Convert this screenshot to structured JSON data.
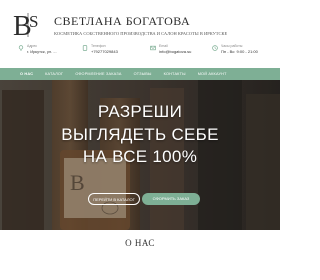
{
  "brand": {
    "name": "СВЕТЛАНА БОГАТОВА",
    "tagline": "КОСМЕТИКА СОБСТВЕННОГО ПРОИЗВОДСТВА И САЛОН КРАСОТЫ В ИРКУТСКЕ",
    "monogram": "BS"
  },
  "contacts": [
    {
      "icon": "location-icon",
      "label": "Адрес",
      "value": "г. Иркутск, ул. ..."
    },
    {
      "icon": "phone-icon",
      "label": "Телефон",
      "value": "+79277029843"
    },
    {
      "icon": "email-icon",
      "label": "Email",
      "value": "info@bogatova.su"
    },
    {
      "icon": "clock-icon",
      "label": "Часы работы",
      "value": "Пн - Вс: 9:00 - 21:00"
    }
  ],
  "nav": {
    "items": [
      "О НАС",
      "КАТАЛОГ",
      "ОФОРМЛЕНИЕ ЗАКАЗА",
      "ОТЗЫВЫ",
      "КОНТАКТЫ",
      "МОЙ АККАУНТ"
    ]
  },
  "hero": {
    "line1": "РАЗРЕШИ",
    "line2": "ВЫГЛЯДЕТЬ СЕБЕ",
    "line3": "НА ВСЕ 100%",
    "button_catalog": "ПЕРЕЙТИ В КАТАЛОГ",
    "button_order": "ОФОРМИТЬ ЗАКАЗ"
  },
  "about": {
    "title": "О НАС"
  },
  "colors": {
    "accent": "#7eaf95"
  }
}
